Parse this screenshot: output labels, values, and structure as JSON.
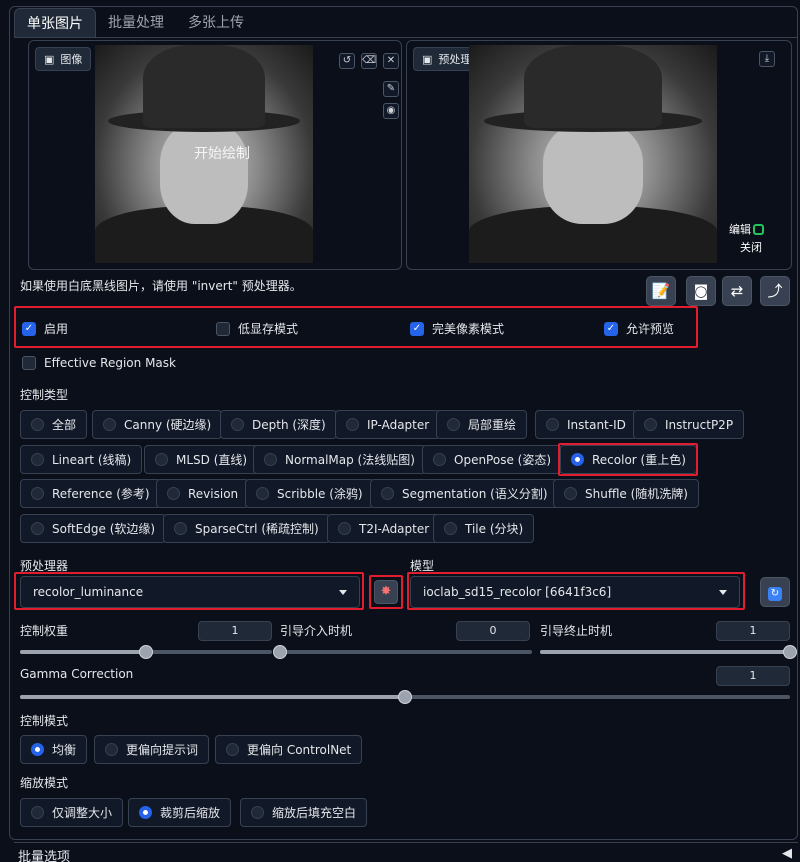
{
  "tabs": [
    "单张图片",
    "批量处理",
    "多张上传"
  ],
  "image_panel": {
    "label": "图像",
    "overlay_text": "开始绘制"
  },
  "preview_panel": {
    "label": "预处理结果预览",
    "edit_label": "编辑",
    "close_label": "关闭"
  },
  "hint": "如果使用白底黑线图片，请使用 \"invert\" 预处理器。",
  "checkboxes": [
    {
      "label": "启用",
      "checked": true
    },
    {
      "label": "低显存模式",
      "checked": false
    },
    {
      "label": "完美像素模式",
      "checked": true
    },
    {
      "label": "允许预览",
      "checked": true
    }
  ],
  "region_mask": {
    "label": "Effective Region Mask",
    "checked": false
  },
  "control_type": {
    "title": "控制类型",
    "options": [
      "全部",
      "Canny (硬边缘)",
      "Depth (深度)",
      "IP-Adapter",
      "局部重绘",
      "Instant-ID",
      "InstructP2P",
      "Lineart (线稿)",
      "MLSD (直线)",
      "NormalMap (法线贴图)",
      "OpenPose (姿态)",
      "Recolor (重上色)",
      "Reference (参考)",
      "Revision",
      "Scribble (涂鸦)",
      "Segmentation (语义分割)",
      "Shuffle (随机洗牌)",
      "SoftEdge (软边缘)",
      "SparseCtrl (稀疏控制)",
      "T2I-Adapter",
      "Tile (分块)"
    ],
    "selected": "Recolor (重上色)"
  },
  "preprocessor": {
    "title": "预处理器",
    "value": "recolor_luminance"
  },
  "model": {
    "title": "模型",
    "value": "ioclab_sd15_recolor [6641f3c6]"
  },
  "sliders": {
    "weight": {
      "label": "控制权重",
      "value": "1",
      "level": 0.5
    },
    "start": {
      "label": "引导介入时机",
      "value": "0",
      "level": 0
    },
    "end": {
      "label": "引导终止时机",
      "value": "1",
      "level": 1
    },
    "gamma": {
      "label": "Gamma Correction",
      "value": "1",
      "level": 0.5
    }
  },
  "control_mode": {
    "title": "控制模式",
    "options": [
      "均衡",
      "更偏向提示词",
      "更偏向 ControlNet"
    ],
    "selected": "均衡"
  },
  "resize_mode": {
    "title": "缩放模式",
    "options": [
      "仅调整大小",
      "裁剪后缩放",
      "缩放后填充空白"
    ],
    "selected": "裁剪后缩放"
  },
  "footer": "批量选项",
  "colors": {
    "accent": "#2563eb",
    "highlight": "#e11d2f",
    "bg": "#0b0f19"
  }
}
